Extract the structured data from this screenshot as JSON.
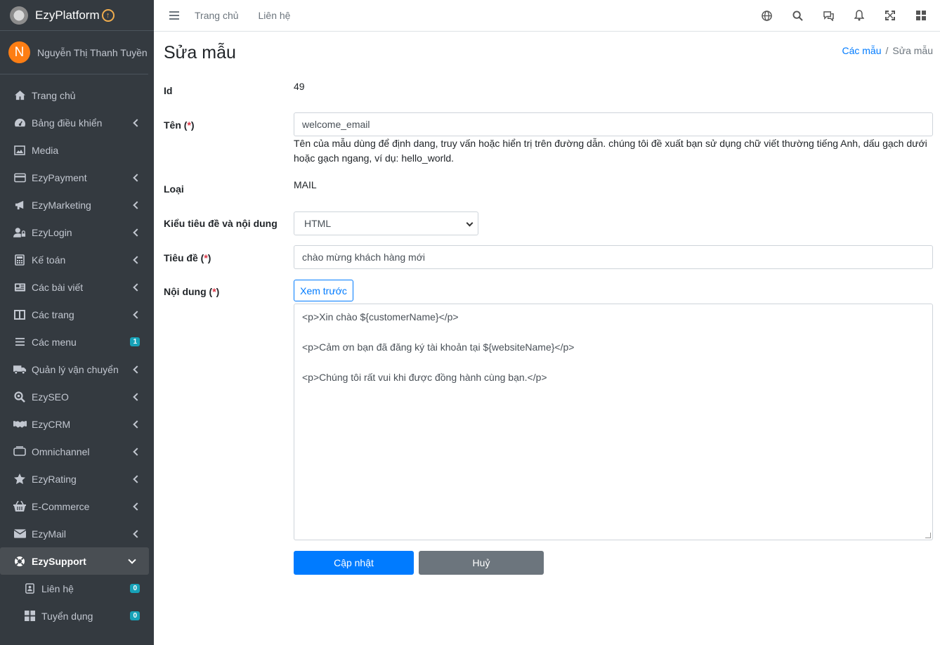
{
  "brand": {
    "name": "EzyPlatform"
  },
  "user": {
    "initial": "N",
    "name": "Nguyễn Thị Thanh Tuyền"
  },
  "sidebar": {
    "items": [
      {
        "label": "Trang chủ",
        "icon": "home-icon",
        "chevron": false
      },
      {
        "label": "Bảng điều khiển",
        "icon": "dashboard-icon",
        "chevron": true
      },
      {
        "label": "Media",
        "icon": "image-icon",
        "chevron": false
      },
      {
        "label": "EzyPayment",
        "icon": "credit-card-icon",
        "chevron": true
      },
      {
        "label": "EzyMarketing",
        "icon": "bullhorn-icon",
        "chevron": true
      },
      {
        "label": "EzyLogin",
        "icon": "user-lock-icon",
        "chevron": true
      },
      {
        "label": "Kế toán",
        "icon": "calculator-icon",
        "chevron": true
      },
      {
        "label": "Các bài viết",
        "icon": "newspaper-icon",
        "chevron": true
      },
      {
        "label": "Các trang",
        "icon": "columns-icon",
        "chevron": true
      },
      {
        "label": "Các menu",
        "icon": "bars-icon",
        "badge": "1"
      },
      {
        "label": "Quản lý vận chuyển",
        "icon": "truck-icon",
        "chevron": true
      },
      {
        "label": "EzySEO",
        "icon": "search-location-icon",
        "chevron": true
      },
      {
        "label": "EzyCRM",
        "icon": "handshake-icon",
        "chevron": true
      },
      {
        "label": "Omnichannel",
        "icon": "tv-icon",
        "chevron": true
      },
      {
        "label": "EzyRating",
        "icon": "star-icon",
        "chevron": true
      },
      {
        "label": "E-Commerce",
        "icon": "shopping-basket-icon",
        "chevron": true
      },
      {
        "label": "EzyMail",
        "icon": "envelope-icon",
        "chevron": true
      },
      {
        "label": "EzySupport",
        "icon": "life-ring-icon",
        "active": true
      }
    ],
    "sub_items": [
      {
        "label": "Liên hệ",
        "icon": "contact-icon",
        "badge": "0"
      },
      {
        "label": "Tuyển dụng",
        "icon": "grid-icon",
        "badge": "0"
      }
    ]
  },
  "topbar": {
    "links": [
      "Trang chủ",
      "Liên hệ"
    ]
  },
  "page": {
    "title": "Sửa mẫu",
    "breadcrumb": {
      "link": "Các mẫu",
      "separator": "/",
      "current": "Sửa mẫu"
    }
  },
  "form": {
    "id_label": "Id",
    "id_value": "49",
    "name_label": "Tên (",
    "name_required": "*",
    "name_close": ")",
    "name_value": "welcome_email",
    "name_help": "Tên của mẫu dùng để định dang, truy vấn hoặc hiển trị trên đường dẫn. chúng tôi đề xuất bạn sử dụng chữ viết thường tiếng Anh, dấu gạch dưới hoặc gạch ngang, ví dụ: hello_world.",
    "type_label": "Loại",
    "type_value": "MAIL",
    "format_label": "Kiểu tiêu đề và nội dung",
    "format_value": "HTML",
    "subject_label": "Tiêu đề (",
    "subject_required": "*",
    "subject_close": ")",
    "subject_value": "chào mừng khách hàng mới",
    "content_label": "Nội dung (",
    "content_required": "*",
    "content_close": ")",
    "preview_button": "Xem trước",
    "content_lines": [
      "<p>Xin chào ${customerName}</p>",
      "",
      "<p>Cảm ơn bạn đã đăng ký tài khoản tại ${websiteName}</p>",
      "",
      "<p>Chúng tôi rất vui khi được đồng hành cùng bạn.</p>"
    ],
    "update_button": "Cập nhật",
    "cancel_button": "Huỷ"
  },
  "colors": {
    "primary": "#007bff",
    "sidebar": "#343a40",
    "required": "#dc3545",
    "badge": "#17a2b8",
    "avatar": "#fd7e14"
  }
}
